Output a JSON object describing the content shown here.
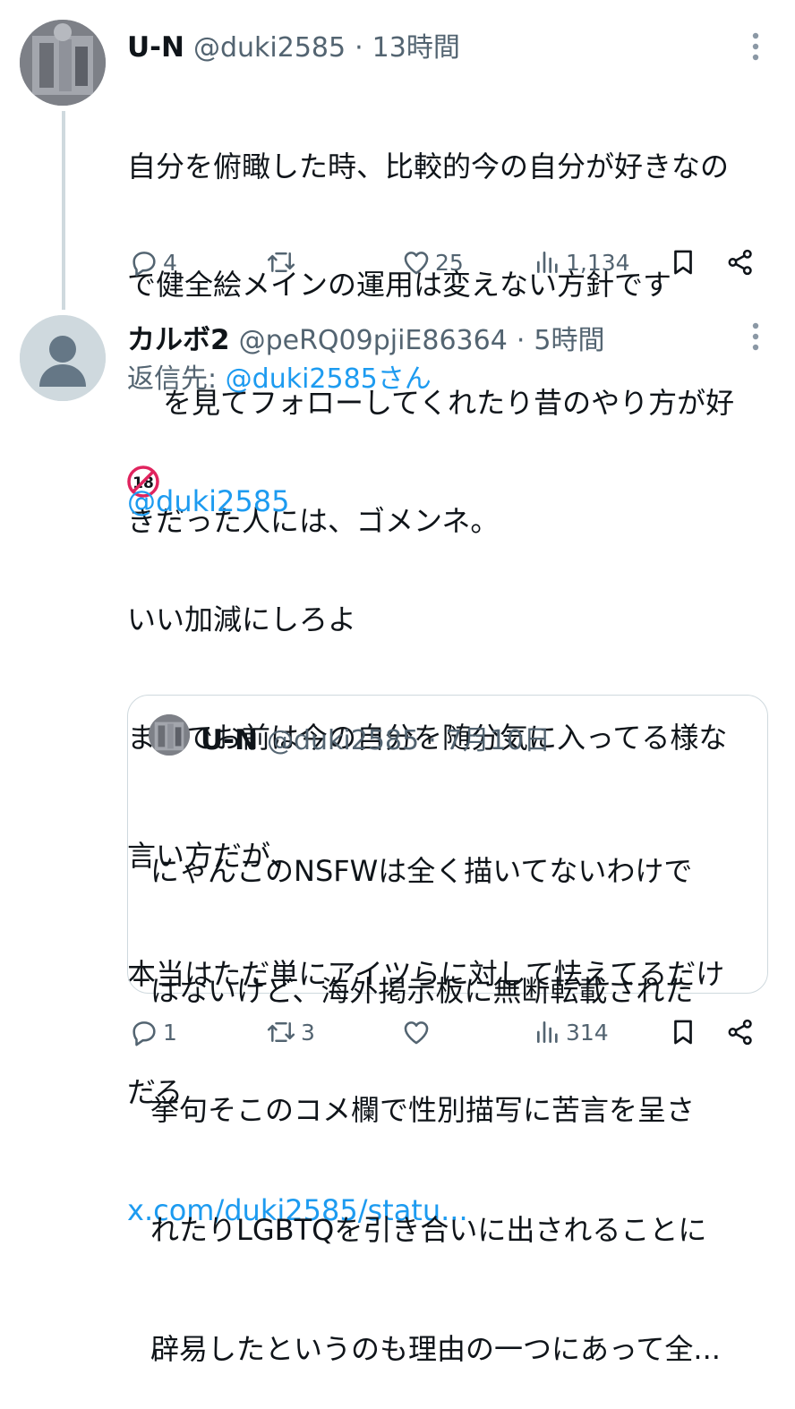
{
  "tweet1": {
    "name": "U-N",
    "handle": "@duki2585",
    "sep": "·",
    "time": "13時間",
    "lines": [
      "自分を俯瞰した時、比較的今の自分が好きなの",
      "で健全絵メインの運用は変えない方針です",
      "を見てフォローしてくれたり昔のやり方が好",
      "きだった人には、ゴメンネ。"
    ],
    "emoji_label": "18",
    "replies": "4",
    "retweets": "",
    "likes": "25",
    "views": "1,134"
  },
  "tweet2": {
    "name": "カルボ2",
    "handle": "@peRQ09pjiE86364",
    "sep": "·",
    "time": "5時間",
    "reply_prefix": "返信先: ",
    "reply_to": "@duki2585さん",
    "mention": "@duki2585",
    "lines": [
      "いい加減にしろよ",
      "まるでお前は今の自分を随分気に入ってる様な",
      "言い方だが、",
      "本当はただ単にアイツらに対して怯えてるだけ",
      "だろ"
    ],
    "url": "x.com/duki2585/statu...",
    "replies": "1",
    "retweets": "3",
    "likes": "",
    "views": "314"
  },
  "quote": {
    "name": "U-N",
    "handle": "@duki2585",
    "sep": "·",
    "date": "7月10日",
    "lines": [
      "にゃんこのNSFWは全く描いてないわけで",
      "はないけど、海外掲示板に無断転載された",
      "挙句そこのコメ欄で性別描写に苦言を呈さ",
      "れたりLGBTQを引き合いに出されることに",
      "辟易したというのも理由の一つにあって全..."
    ]
  },
  "colors": {
    "text": "#0f1419",
    "secondary": "#536471",
    "link": "#1d9bf0",
    "border": "#cfd9de",
    "emoji_red": "#e0245e"
  },
  "icons": [
    "reply-icon",
    "retweet-icon",
    "like-icon",
    "views-icon",
    "bookmark-icon",
    "share-icon",
    "more-icon",
    "under18-icon"
  ]
}
